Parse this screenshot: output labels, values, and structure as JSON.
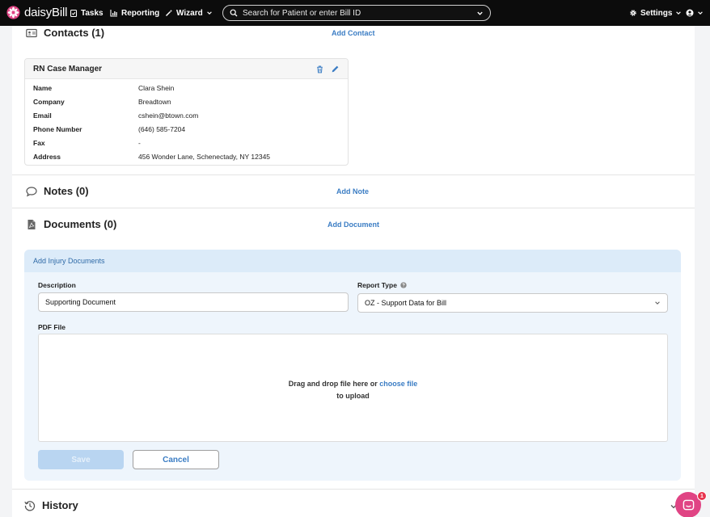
{
  "nav": {
    "brand": "daisyBill",
    "tasks": "Tasks",
    "reporting": "Reporting",
    "wizard": "Wizard",
    "search_placeholder": "Search for Patient or enter Bill ID",
    "settings": "Settings",
    "brand_color": "#e04484"
  },
  "contacts": {
    "title": "Contacts (1)",
    "add_label": "Add Contact",
    "card": {
      "title": "RN Case Manager",
      "rows": [
        {
          "label": "Name",
          "value": "Clara Shein"
        },
        {
          "label": "Company",
          "value": "Breadtown"
        },
        {
          "label": "Email",
          "value": "cshein@btown.com"
        },
        {
          "label": "Phone Number",
          "value": "(646) 585-7204"
        },
        {
          "label": "Fax",
          "value": "-"
        },
        {
          "label": "Address",
          "value": "456 Wonder Lane, Schenectady, NY 12345"
        }
      ]
    }
  },
  "notes": {
    "title": "Notes (0)",
    "add_label": "Add Note"
  },
  "documents": {
    "title": "Documents (0)",
    "add_label": "Add Document",
    "form": {
      "header": "Add Injury Documents",
      "description_label": "Description",
      "description_value": "Supporting Document",
      "report_type_label": "Report Type",
      "report_type_value": "OZ - Support Data for Bill",
      "pdf_label": "PDF File",
      "drop_text": "Drag and drop file here or",
      "choose_file": "choose file",
      "drop_text2": "to upload",
      "save_label": "Save",
      "cancel_label": "Cancel"
    }
  },
  "history": {
    "title": "History"
  },
  "chat": {
    "badge": "1"
  }
}
